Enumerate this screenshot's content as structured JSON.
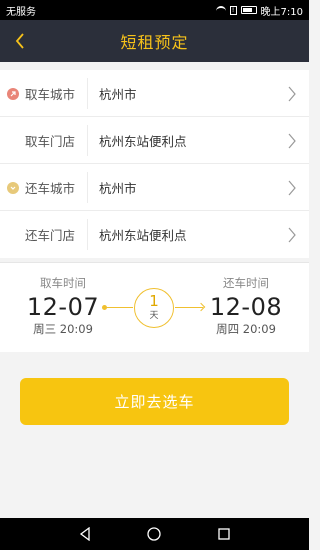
{
  "status_bar": {
    "carrier": "无服务",
    "time": "晚上7:10"
  },
  "header": {
    "title": "短租预定"
  },
  "form": {
    "rows": [
      {
        "label": "取车城市",
        "value": "杭州市",
        "icon": "pickup-dot-icon"
      },
      {
        "label": "取车门店",
        "value": "杭州东站便利点"
      },
      {
        "label": "还车城市",
        "value": "杭州市",
        "icon": "return-dot-icon"
      },
      {
        "label": "还车门店",
        "value": "杭州东站便利点"
      }
    ]
  },
  "time": {
    "pickup": {
      "label": "取车时间",
      "date": "12-07",
      "day": "周三 20:09"
    },
    "return": {
      "label": "还车时间",
      "date": "12-08",
      "day": "周四 20:09"
    },
    "duration": {
      "num": "1",
      "unit": "天"
    }
  },
  "cta": {
    "label": "立即去选车"
  },
  "colors": {
    "accent": "#f7c510",
    "header_bg": "#2b2f3a",
    "title": "#f6c21a"
  }
}
